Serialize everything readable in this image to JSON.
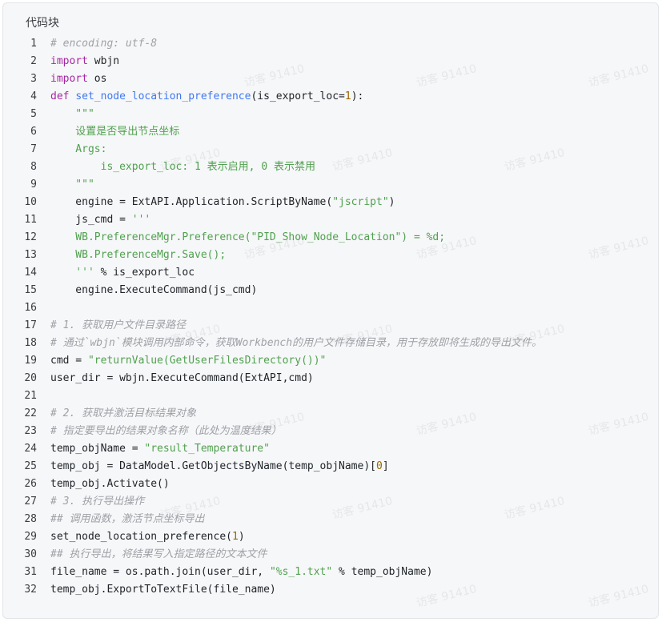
{
  "header": {
    "title": "代码块"
  },
  "watermark": "访客 91410",
  "code_lines": [
    [
      {
        "t": "cmt",
        "v": "# encoding: utf-8"
      }
    ],
    [
      {
        "t": "kw",
        "v": "import"
      },
      {
        "t": "plain",
        "v": " wbjn"
      }
    ],
    [
      {
        "t": "kw",
        "v": "import"
      },
      {
        "t": "plain",
        "v": " os"
      }
    ],
    [
      {
        "t": "kw",
        "v": "def"
      },
      {
        "t": "plain",
        "v": " "
      },
      {
        "t": "fn",
        "v": "set_node_location_preference"
      },
      {
        "t": "plain",
        "v": "(is_export_loc="
      },
      {
        "t": "num",
        "v": "1"
      },
      {
        "t": "plain",
        "v": "):"
      }
    ],
    [
      {
        "t": "str",
        "v": "    \"\"\""
      }
    ],
    [
      {
        "t": "str",
        "v": "    设置是否导出节点坐标"
      }
    ],
    [
      {
        "t": "str",
        "v": "    Args:"
      }
    ],
    [
      {
        "t": "str",
        "v": "        is_export_loc: 1 表示启用, 0 表示禁用"
      }
    ],
    [
      {
        "t": "str",
        "v": "    \"\"\""
      }
    ],
    [
      {
        "t": "plain",
        "v": "    engine = ExtAPI.Application.ScriptByName("
      },
      {
        "t": "str",
        "v": "\"jscript\""
      },
      {
        "t": "plain",
        "v": ")"
      }
    ],
    [
      {
        "t": "plain",
        "v": "    js_cmd = "
      },
      {
        "t": "str",
        "v": "'''"
      }
    ],
    [
      {
        "t": "str",
        "v": "    WB.PreferenceMgr.Preference(\"PID_Show_Node_Location\") = %d;"
      }
    ],
    [
      {
        "t": "str",
        "v": "    WB.PreferenceMgr.Save();"
      }
    ],
    [
      {
        "t": "str",
        "v": "    '''"
      },
      {
        "t": "plain",
        "v": " % is_export_loc"
      }
    ],
    [
      {
        "t": "plain",
        "v": "    engine.ExecuteCommand(js_cmd)"
      }
    ],
    [],
    [
      {
        "t": "cmt",
        "v": "# 1. 获取用户文件目录路径"
      }
    ],
    [
      {
        "t": "cmt",
        "v": "# 通过`wbjn`模块调用内部命令，获取Workbench的用户文件存储目录，用于存放即将生成的导出文件。"
      }
    ],
    [
      {
        "t": "plain",
        "v": "cmd = "
      },
      {
        "t": "str",
        "v": "\"returnValue(GetUserFilesDirectory())\""
      }
    ],
    [
      {
        "t": "plain",
        "v": "user_dir = wbjn.ExecuteCommand(ExtAPI,cmd)"
      }
    ],
    [],
    [
      {
        "t": "cmt",
        "v": "# 2. 获取并激活目标结果对象"
      }
    ],
    [
      {
        "t": "cmt",
        "v": "# 指定要导出的结果对象名称（此处为温度结果）"
      }
    ],
    [
      {
        "t": "plain",
        "v": "temp_objName = "
      },
      {
        "t": "str",
        "v": "\"result_Temperature\""
      }
    ],
    [
      {
        "t": "plain",
        "v": "temp_obj = DataModel.GetObjectsByName(temp_objName)["
      },
      {
        "t": "num",
        "v": "0"
      },
      {
        "t": "plain",
        "v": "]"
      }
    ],
    [
      {
        "t": "plain",
        "v": "temp_obj.Activate()"
      }
    ],
    [
      {
        "t": "cmt",
        "v": "# 3. 执行导出操作"
      }
    ],
    [
      {
        "t": "cmt",
        "v": "## 调用函数，激活节点坐标导出"
      }
    ],
    [
      {
        "t": "plain",
        "v": "set_node_location_preference("
      },
      {
        "t": "num",
        "v": "1"
      },
      {
        "t": "plain",
        "v": ")"
      }
    ],
    [
      {
        "t": "cmt",
        "v": "## 执行导出，将结果写入指定路径的文本文件"
      }
    ],
    [
      {
        "t": "plain",
        "v": "file_name = os.path.join(user_dir, "
      },
      {
        "t": "str",
        "v": "\"%s_1.txt\""
      },
      {
        "t": "plain",
        "v": " % temp_objName)"
      }
    ],
    [
      {
        "t": "plain",
        "v": "temp_obj.ExportToTextFile(file_name)"
      }
    ]
  ]
}
